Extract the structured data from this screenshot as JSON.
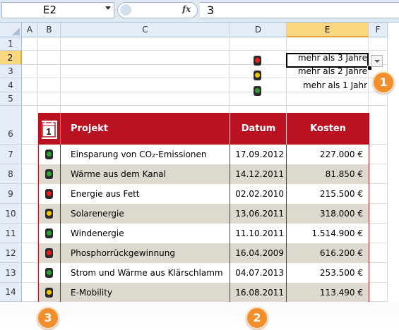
{
  "formula_bar": {
    "name_box": "E2",
    "fx_label": "fx",
    "value": "3"
  },
  "columns": [
    "A",
    "B",
    "C",
    "D",
    "E",
    "F"
  ],
  "rows": [
    "1",
    "2",
    "3",
    "4",
    "5",
    "6",
    "7",
    "8",
    "9",
    "10",
    "11",
    "12",
    "13",
    "14"
  ],
  "selected_cell": {
    "column": "E",
    "row": "2"
  },
  "legend": [
    {
      "light": "red",
      "label": "mehr als 3 Jahre"
    },
    {
      "light": "yellow",
      "label": "mehr als 2 Jahre"
    },
    {
      "light": "green",
      "label": "mehr als 1 Jahr"
    }
  ],
  "calendar_icon_number": "1",
  "table": {
    "headers": {
      "projekt": "Projekt",
      "datum": "Datum",
      "kosten": "Kosten"
    },
    "rows": [
      {
        "status": "green",
        "projekt": "Einsparung von CO₂-Emissionen",
        "datum": "17.09.2012",
        "kosten": "227.000 €"
      },
      {
        "status": "green",
        "projekt": "Wärme aus dem Kanal",
        "datum": "14.12.2011",
        "kosten": "81.850 €"
      },
      {
        "status": "red",
        "projekt": "Energie aus Fett",
        "datum": "02.02.2010",
        "kosten": "215.500 €"
      },
      {
        "status": "yellow",
        "projekt": "Solarenergie",
        "datum": "13.06.2011",
        "kosten": "318.000 €"
      },
      {
        "status": "green",
        "projekt": "Windenergie",
        "datum": "11.10.2011",
        "kosten": "1.514.900 €"
      },
      {
        "status": "red",
        "projekt": "Phosphorrückgewinnung",
        "datum": "16.04.2009",
        "kosten": "616.200 €"
      },
      {
        "status": "green",
        "projekt": "Strom und Wärme aus Klärschlamm",
        "datum": "04.07.2013",
        "kosten": "253.500 €"
      },
      {
        "status": "yellow",
        "projekt": "E-Mobility",
        "datum": "16.08.2011",
        "kosten": "113.490 €"
      }
    ]
  },
  "callouts": [
    "1",
    "2",
    "3"
  ],
  "colors": {
    "header_red": "#bb1221",
    "row_band": "#ddd9cf",
    "selection": "#f8d77f",
    "callout": "#f08f2c",
    "light_red": "#e8201c",
    "light_yellow": "#f5c400",
    "light_green": "#2fa232"
  }
}
